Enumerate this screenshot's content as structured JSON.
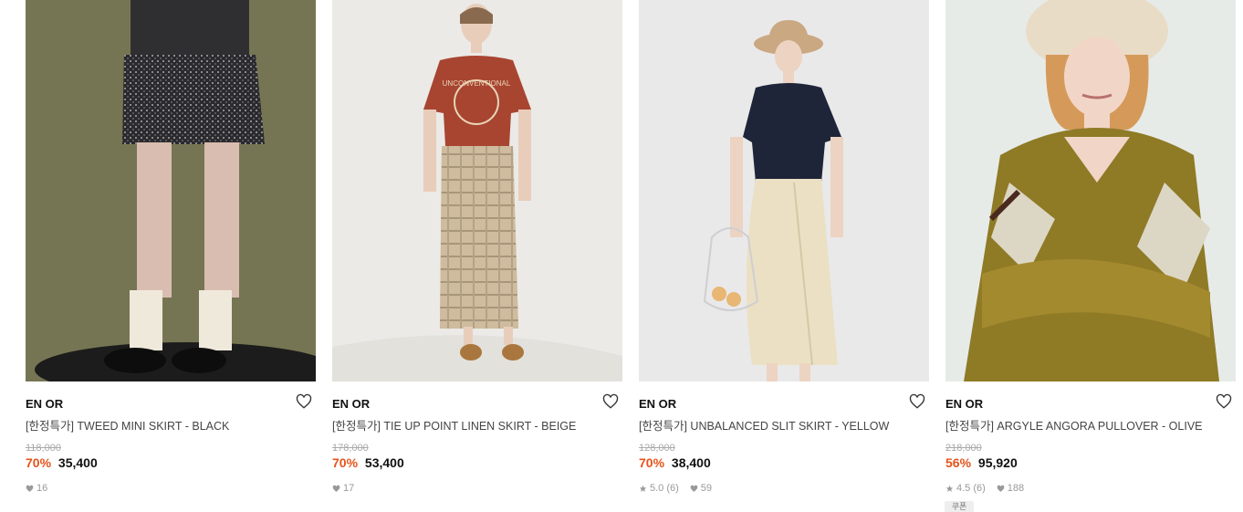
{
  "products": [
    {
      "brand": "EN OR",
      "name": "[한정특가] TWEED MINI SKIRT - BLACK",
      "original_price": "118,000",
      "discount": "70%",
      "price": "35,400",
      "rating": "",
      "likes": "16"
    },
    {
      "brand": "EN OR",
      "name": "[한정특가] TIE UP POINT LINEN SKIRT - BEIGE",
      "original_price": "178,000",
      "discount": "70%",
      "price": "53,400",
      "rating": "",
      "likes": "17"
    },
    {
      "brand": "EN OR",
      "name": "[한정특가] UNBALANCED SLIT SKIRT - YELLOW",
      "original_price": "128,000",
      "discount": "70%",
      "price": "38,400",
      "rating": "5.0 (6)",
      "likes": "59"
    },
    {
      "brand": "EN OR",
      "name": "[한정특가] ARGYLE ANGORA PULLOVER - OLIVE",
      "original_price": "218,000",
      "discount": "56%",
      "price": "95,920",
      "rating": "4.5 (6)",
      "likes": "188"
    }
  ],
  "coupon_label": "쿠폰",
  "icons": {
    "wishlist": "heart-outline-icon",
    "likes": "heart-icon",
    "rating": "star-icon"
  },
  "colors": {
    "discount": "#e5541b",
    "brand_text": "#111111",
    "muted": "#999999"
  }
}
